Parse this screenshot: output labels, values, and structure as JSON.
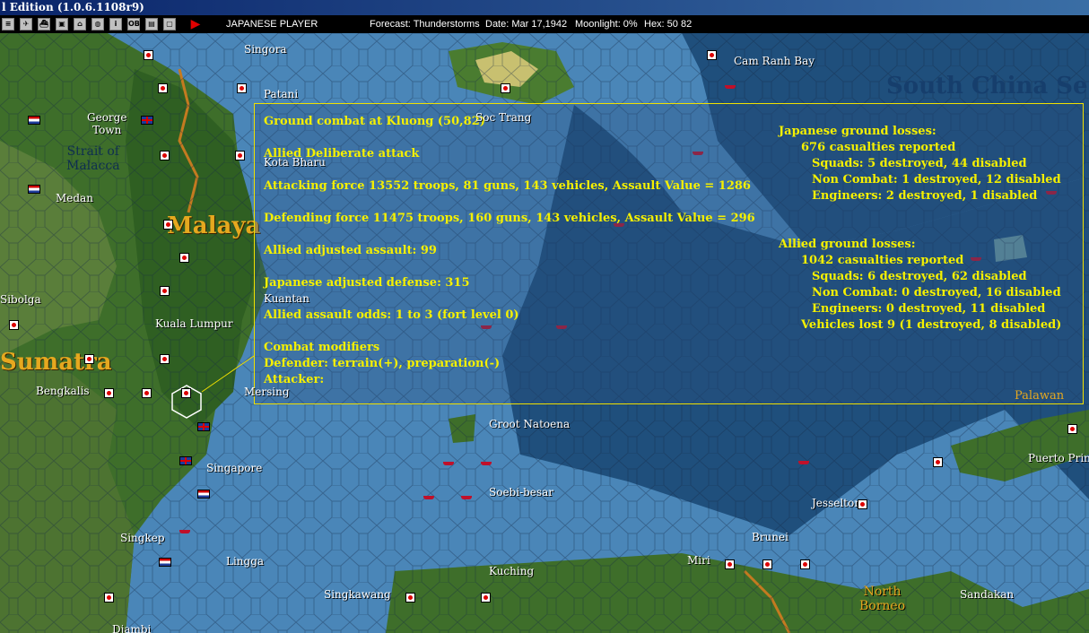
{
  "window": {
    "title": "l Edition (1.0.6.1108r9)"
  },
  "toolbar": {
    "buttons": [
      {
        "name": "menu-button",
        "glyph": "≡"
      },
      {
        "name": "aircraft-button",
        "glyph": "✈"
      },
      {
        "name": "ship-button",
        "glyph": "⛴"
      },
      {
        "name": "ground-button",
        "glyph": "▣"
      },
      {
        "name": "base-button",
        "glyph": "⌂"
      },
      {
        "name": "globe-button",
        "glyph": "◍"
      },
      {
        "name": "info-button",
        "glyph": "i"
      },
      {
        "name": "ob-button",
        "glyph": "OB"
      },
      {
        "name": "reports-button",
        "glyph": "▤"
      },
      {
        "name": "window-button",
        "glyph": "▢"
      }
    ],
    "end_turn_glyph": "▶",
    "player": "JAPANESE PLAYER",
    "forecast": "Forecast: Thunderstorms",
    "date": "Date: Mar 17,1942",
    "moonlight": "Moonlight: 0%",
    "hex": "Hex: 50 82"
  },
  "map": {
    "labels": {
      "singora": "Singora",
      "patani": "Patani",
      "george_town": "George\nTown",
      "strait": "Strait of\nMalacca",
      "medan": "Medan",
      "kota_bharu": "Kota Bharu",
      "malaya": "Malaya",
      "sibolga": "Sibolga",
      "kuantan": "Kuantan",
      "kuala_lumpur": "Kuala Lumpur",
      "sumatra": "Sumatra",
      "bengkalis": "Bengkalis",
      "mersing": "Mersing",
      "singapore": "Singapore",
      "singkep": "Singkep",
      "lingga": "Lingga",
      "djambi": "Djambi",
      "soc_trang": "Soc Trang",
      "cam_ranh": "Cam Ranh Bay",
      "south_china_sea": "South China Se",
      "groot_natoena": "Groot Natoena",
      "soebi_besar": "Soebi-besar",
      "kuching": "Kuching",
      "singkawang": "Singkawang",
      "jesselton": "Jesselton",
      "brunei": "Brunei",
      "miri": "Miri",
      "north_borneo": "North\nBorneo",
      "sandakan": "Sandakan",
      "palawan": "Palawan",
      "puerto_princesa": "Puerto Prin"
    }
  },
  "combat_report": {
    "title": "Ground combat at Kluong (50,82)",
    "attack_type": "Allied Deliberate attack",
    "attacking_force": "Attacking force 13552 troops, 81 guns, 143 vehicles, Assault Value = 1286",
    "defending_force": "Defending force 11475 troops, 160 guns, 143 vehicles, Assault Value = 296",
    "allied_adjusted": "Allied adjusted assault: 99",
    "japanese_adjusted": "Japanese adjusted defense: 315",
    "odds": "Allied assault odds: 1 to 3 (fort level 0)",
    "modifiers_heading": "Combat modifiers",
    "defender_mods": "Defender: terrain(+), preparation(-)",
    "attacker_mods": "Attacker:",
    "japanese_losses": {
      "heading": "Japanese ground losses:",
      "casualties": "676 casualties reported",
      "squads": "Squads: 5 destroyed, 44 disabled",
      "non_combat": "Non Combat: 1 destroyed, 12 disabled",
      "engineers": "Engineers: 2 destroyed, 1 disabled"
    },
    "allied_losses": {
      "heading": "Allied ground losses:",
      "casualties": "1042 casualties reported",
      "squads": "Squads: 6 destroyed, 62 disabled",
      "non_combat": "Non Combat: 0 destroyed, 16 disabled",
      "engineers": "Engineers: 0 destroyed, 11 disabled",
      "vehicles": "Vehicles lost 9 (1 destroyed, 8 disabled)"
    }
  },
  "colors": {
    "sea": "#4a86b8",
    "deep_sea": "#1f4f7c",
    "land": "#3e6e2a",
    "report_text": "#f5f000"
  }
}
